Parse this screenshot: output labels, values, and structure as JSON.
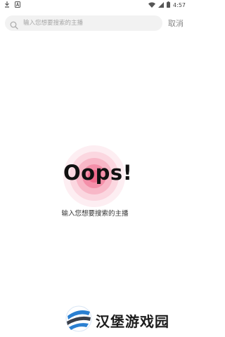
{
  "status_bar": {
    "time": "4:57",
    "icons": [
      "download-icon",
      "notification-a-icon",
      "wifi-icon",
      "signal-icon",
      "battery-icon"
    ]
  },
  "search": {
    "placeholder": "输入您想要搜索的主播",
    "value": "",
    "cancel_label": "取消"
  },
  "empty_state": {
    "title": "Oops!",
    "message": "输入您想要搜索的主播",
    "accent_color": "#f06a8c"
  },
  "watermark": {
    "text": "汉堡游戏园"
  }
}
